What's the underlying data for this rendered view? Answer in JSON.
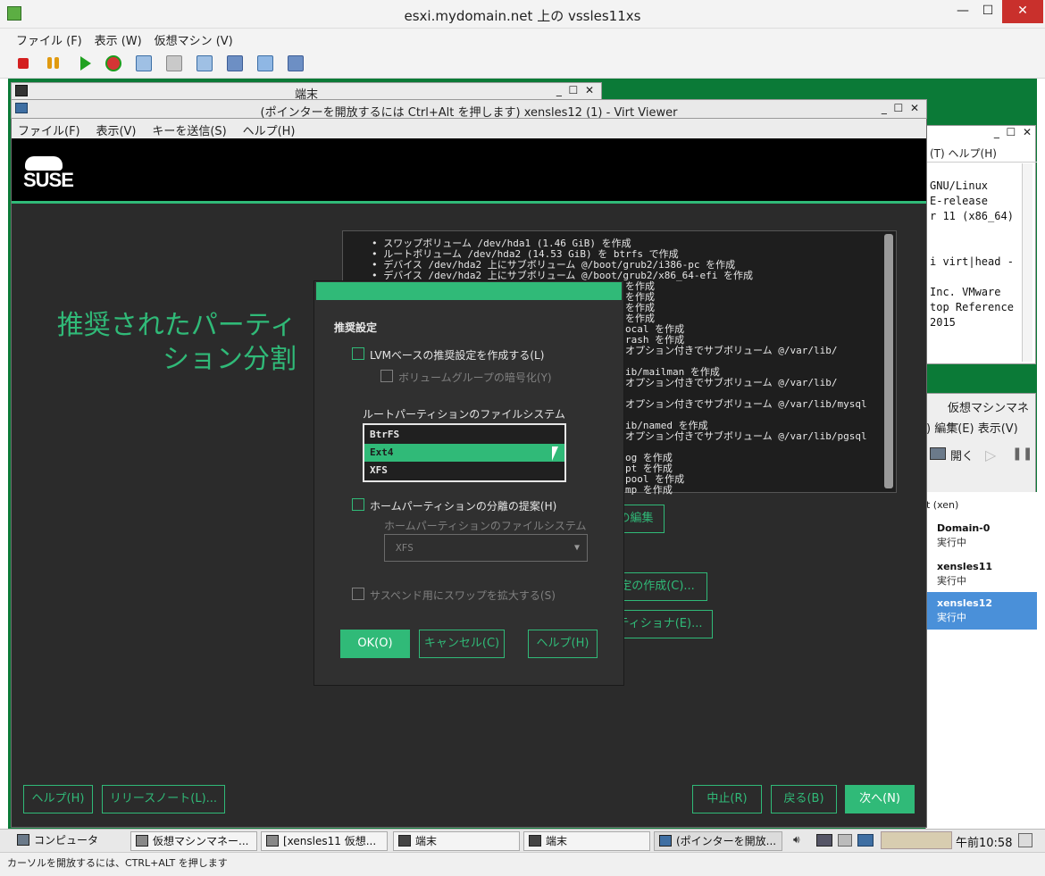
{
  "outer_window": {
    "title": "esxi.mydomain.net 上の vssles11xs",
    "menu": [
      "ファイル (F)",
      "表示 (W)",
      "仮想マシン (V)"
    ],
    "toolbar_icons": [
      "stop-icon",
      "pause-icon",
      "play-icon",
      "reset-icon",
      "snapshot-icon",
      "snapshot-manager-icon",
      "revert-icon",
      "network-icon",
      "settings-icon",
      "console-icon"
    ]
  },
  "terminal_window": {
    "title": "端末"
  },
  "virt_viewer": {
    "title": "(ポインターを開放するには Ctrl+Alt を押します) xensles12 (1) - Virt Viewer",
    "menu": [
      "ファイル(F)",
      "表示(V)",
      "キーを送信(S)",
      "ヘルプ(H)"
    ]
  },
  "installer": {
    "logo": "SUSE",
    "heading_line1": "推奨されたパーティ",
    "heading_line2": "ション分割",
    "log_lines": [
      "•  スワップボリューム /dev/hda1 (1.46 GiB) を作成",
      "•  ルートボリューム /dev/hda2 (14.53 GiB) を btrfs で作成",
      "•  デバイス /dev/hda2 上にサブボリューム @/boot/grub2/i386-pc を作成",
      "•  デバイス /dev/hda2 上にサブボリューム @/boot/grub2/x86_64-efi を作成",
      "を作成",
      "を作成",
      "を作成",
      "を作成",
      "ocal を作成",
      "rash を作成",
      "オプション付きでサブボリューム @/var/lib/",
      "",
      "ib/mailman を作成",
      "オプション付きでサブボリューム @/var/lib/",
      "",
      "オプション付きでサブボリューム @/var/lib/mysql",
      "",
      "ib/named を作成",
      "オプション付きでサブボリューム @/var/lib/pgsql",
      "",
      "og を作成",
      "pt を作成",
      "pool を作成",
      "mp を作成"
    ],
    "btn_edit": "の編集",
    "btn_create": "定の作成(C)...",
    "btn_partitioner": "ティショナ(E)...",
    "btn_help": "ヘルプ(H)",
    "btn_release_notes": "リリースノート(L)...",
    "btn_abort": "中止(R)",
    "btn_back": "戻る(B)",
    "btn_next": "次へ(N)"
  },
  "dialog": {
    "section_title": "推奨設定",
    "lvm_label": "LVMベースの推奨設定を作成する(L)",
    "encrypt_label": "ボリュームグループの暗号化(Y)",
    "root_fs_label": "ルートパーティションのファイルシステム",
    "root_fs_options": [
      "BtrFS",
      "Ext4",
      "XFS"
    ],
    "root_fs_selected": "Ext4",
    "home_label": "ホームパーティションの分離の提案(H)",
    "home_fs_label": "ホームパーティションのファイルシステム",
    "home_fs_value": "XFS",
    "swap_label": "サスペンド用にスワップを拡大する(S)",
    "ok": "OK(O)",
    "cancel": "キャンセル(C)",
    "help": "ヘルプ(H)"
  },
  "right_terminal": {
    "menu": "(T)  ヘルプ(H)",
    "lines": [
      "GNU/Linux",
      "E-release",
      "r 11 (x86_64)",
      "",
      "i virt|head -",
      "",
      "Inc. VMware",
      "top Reference",
      "2015"
    ]
  },
  "vm_manager": {
    "title": "仮想マシンマネー",
    "menu": ") 編集(E)  表示(V)",
    "open": "開く",
    "host": "t (xen)",
    "vms": [
      {
        "name": "Domain-0",
        "status": "実行中"
      },
      {
        "name": "xensles11",
        "status": "実行中"
      },
      {
        "name": "xensles12",
        "status": "実行中"
      }
    ]
  },
  "taskbar": {
    "items": [
      "コンピュータ",
      "仮想マシンマネー...",
      "[xensles11 仮想...",
      "端末",
      "端末",
      "(ポインターを開放..."
    ],
    "clock": "午前10:58"
  },
  "status_bar": "カーソルを開放するには、CTRL+ALT を押します"
}
